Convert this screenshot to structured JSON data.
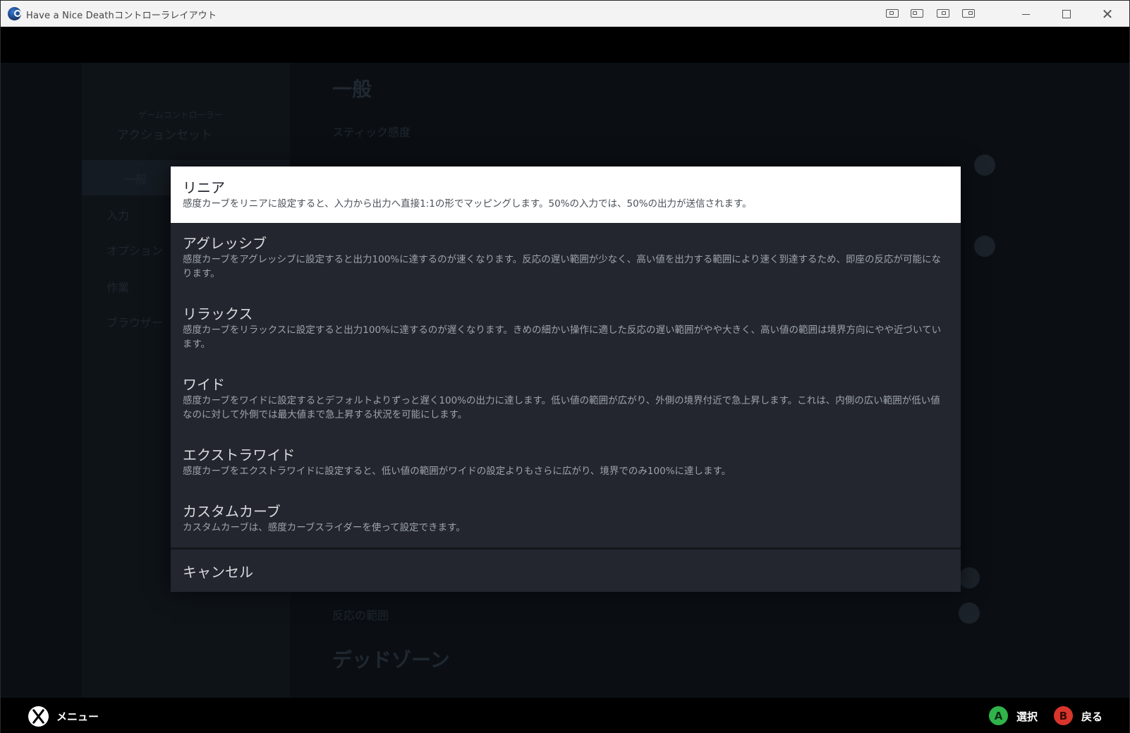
{
  "window": {
    "title": "Have a Nice Deathコントローラレイアウト"
  },
  "background": {
    "left_labels": [
      "ゲームコントローラー",
      "アクションセット",
      "一般",
      "入力",
      "オプション",
      "作業",
      "ブラウザー"
    ],
    "heading_general": "一般",
    "heading_deadzone": "デッドゾーン",
    "row_labels": [
      "スティック感度",
      "反応の範囲"
    ]
  },
  "modal": {
    "options": [
      {
        "title": "リニア",
        "desc": "感度カーブをリニアに設定すると、入力から出力へ直接1:1の形でマッピングします。50%の入力では、50%の出力が送信されます。",
        "selected": true
      },
      {
        "title": "アグレッシブ",
        "desc": "感度カーブをアグレッシブに設定すると出力100%に達するのが速くなります。反応の遅い範囲が少なく、高い値を出力する範囲により速く到達するため、即座の反応が可能になります。",
        "selected": false
      },
      {
        "title": "リラックス",
        "desc": "感度カーブをリラックスに設定すると出力100%に達するのが遅くなります。きめの細かい操作に適した反応の遅い範囲がやや大きく、高い値の範囲は境界方向にやや近づいています。",
        "selected": false
      },
      {
        "title": "ワイド",
        "desc": "感度カーブをワイドに設定するとデフォルトよりずっと遅く100%の出力に達します。低い値の範囲が広がり、外側の境界付近で急上昇します。これは、内側の広い範囲が低い値なのに対して外側では最大値まで急上昇する状況を可能にします。",
        "selected": false
      },
      {
        "title": "エクストラワイド",
        "desc": "感度カーブをエクストラワイドに設定すると、低い値の範囲がワイドの設定よりもさらに広がり、境界でのみ100%に達します。",
        "selected": false
      },
      {
        "title": "カスタムカーブ",
        "desc": "カスタムカーブは、感度カーブスライダーを使って設定できます。",
        "selected": false
      }
    ],
    "cancel_label": "キャンセル"
  },
  "footer": {
    "menu_label": "メニュー",
    "a_glyph": "A",
    "a_label": "選択",
    "b_glyph": "B",
    "b_label": "戻る"
  },
  "colors": {
    "accent_a": "#2fb34a",
    "accent_b": "#d9352b",
    "modal_bg": "#23262e",
    "selected_bg": "#ffffff"
  }
}
